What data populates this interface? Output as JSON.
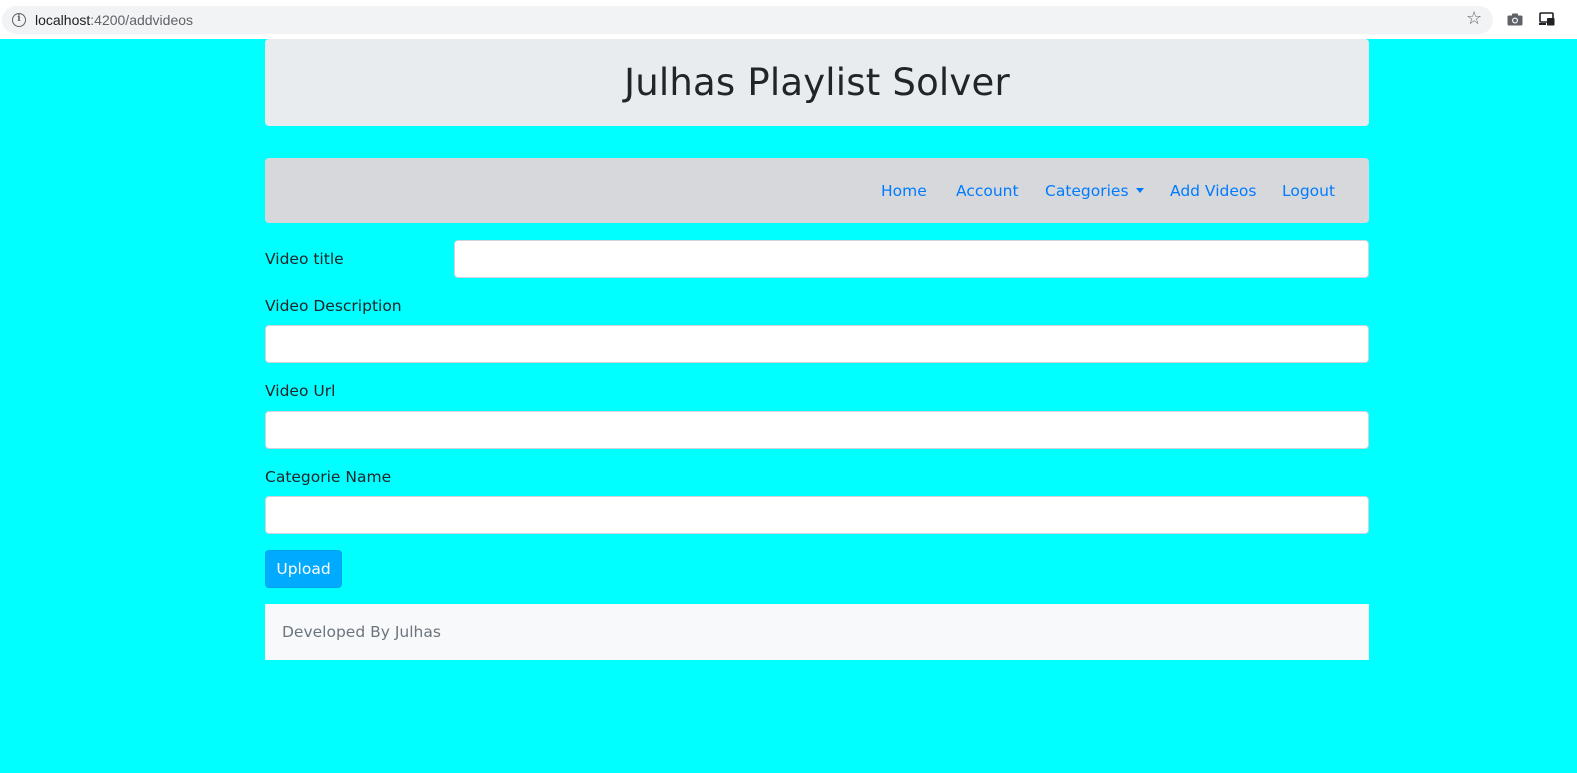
{
  "browser": {
    "url_host": "localhost",
    "url_path": ":4200/addvideos",
    "icons": [
      "info-icon",
      "star-icon",
      "camera-icon",
      "cast-icon"
    ]
  },
  "header": {
    "title": "Julhas Playlist Solver"
  },
  "nav": {
    "items": [
      {
        "label": "Home"
      },
      {
        "label": "Account"
      },
      {
        "label": "Categories",
        "dropdown": true
      },
      {
        "label": "Add Videos"
      },
      {
        "label": "Logout"
      }
    ]
  },
  "form": {
    "video_title_label": "Video title",
    "video_title_value": "",
    "video_description_label": "Video Description",
    "video_description_value": "",
    "video_url_label": "Video Url",
    "video_url_value": "",
    "categorie_name_label": "Categorie Name",
    "categorie_name_value": "",
    "upload_label": "Upload"
  },
  "footer": {
    "text": "Developed By Julhas"
  },
  "colors": {
    "page_background": "#00ffff",
    "link": "#007bff",
    "upload_button": "#00aaff",
    "navbar": "#d6d8db",
    "header": "#e9ecef"
  }
}
